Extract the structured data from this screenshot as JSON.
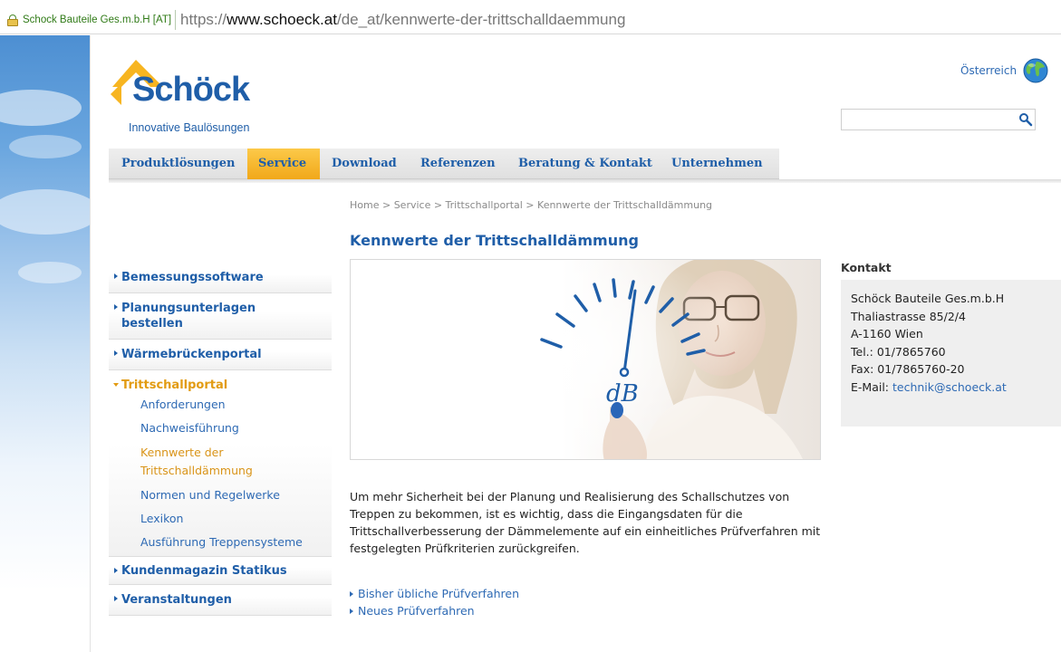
{
  "browser": {
    "ev_name": "Schock Bauteile Ges.m.b.H [AT]",
    "url_scheme": "https://",
    "url_host": "www.schoeck.at",
    "url_path": "/de_at/kennwerte-der-trittschalldaemmung"
  },
  "header": {
    "logo_text": "Schöck",
    "tagline": "Innovative Baulösungen",
    "country": "Österreich",
    "search_placeholder": ""
  },
  "nav": {
    "items": [
      {
        "label": "Produktlösungen"
      },
      {
        "label": "Service"
      },
      {
        "label": "Download"
      },
      {
        "label": "Referenzen"
      },
      {
        "label": "Beratung & Kontakt"
      },
      {
        "label": "Unternehmen"
      }
    ],
    "active": "Service"
  },
  "breadcrumb": "Home > Service > Trittschallportal > Kennwerte der Trittschalldämmung",
  "page_title": "Kennwerte der Trittschalldämmung",
  "sidebar": {
    "items": [
      {
        "label": "Bemessungssoftware"
      },
      {
        "label": "Planungsunterlagen bestellen"
      },
      {
        "label": "Wärmebrückenportal"
      },
      {
        "label": "Trittschallportal",
        "sub": [
          {
            "label": "Anforderungen"
          },
          {
            "label": "Nachweisführung"
          },
          {
            "label": "Kennwerte der Trittschalldämmung"
          },
          {
            "label": "Normen und Regelwerke"
          },
          {
            "label": "Lexikon"
          },
          {
            "label": "Ausführung Treppensysteme"
          }
        ]
      },
      {
        "label": "Kundenmagazin Statikus"
      },
      {
        "label": "Veranstaltungen"
      }
    ]
  },
  "hero": {
    "drawn_text": "dB"
  },
  "content": {
    "intro": "Um mehr Sicherheit bei der Planung und Realisierung des Schallschutzes von Treppen zu bekommen, ist es wichtig, dass die Eingangsdaten für die Trittschallverbesserung der Dämmelemente auf ein einheitliches Prüfverfahren mit festgelegten Prüfkriterien zurückgreifen.",
    "links": [
      {
        "label": "Bisher übliche Prüfverfahren"
      },
      {
        "label": "Neues Prüfverfahren"
      }
    ]
  },
  "kontakt": {
    "title": "Kontakt",
    "company": "Schöck Bauteile Ges.m.b.H",
    "street": "Thaliastrasse 85/2/4",
    "city": "A-1160 Wien",
    "tel": "Tel.: 01/7865760",
    "fax": "Fax: 01/7865760-20",
    "email_prefix": "E-Mail: ",
    "email": "technik@schoeck.at"
  },
  "colors": {
    "brand_blue": "#1f5ea8",
    "accent_orange": "#f1a81a",
    "ev_green": "#2f7a16"
  },
  "icons": [
    "lock-icon",
    "globe-icon",
    "search-icon",
    "arrow-right-icon",
    "arrow-down-icon"
  ]
}
